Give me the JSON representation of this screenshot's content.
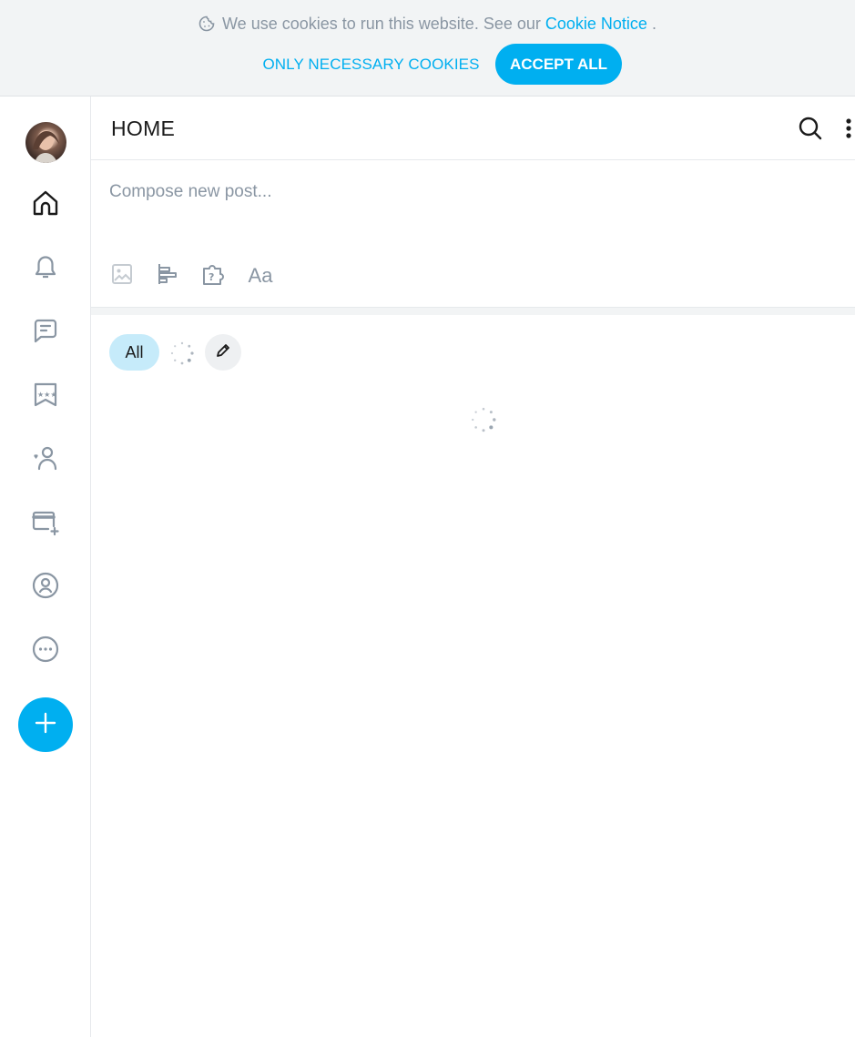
{
  "cookie_banner": {
    "text": "We use cookies to run this website. See our",
    "link_label": "Cookie Notice",
    "suffix": ".",
    "necessary_label": "ONLY NECESSARY COOKIES",
    "accept_label": "ACCEPT ALL",
    "icon": "cookie-icon"
  },
  "sidebar": {
    "items": [
      {
        "name": "home",
        "icon": "home-icon"
      },
      {
        "name": "notifications",
        "icon": "bell-icon"
      },
      {
        "name": "messages",
        "icon": "message-icon"
      },
      {
        "name": "collections",
        "icon": "bookmark-stars-icon"
      },
      {
        "name": "subscriptions",
        "icon": "user-heart-icon"
      },
      {
        "name": "add-card",
        "icon": "card-plus-icon"
      },
      {
        "name": "my-profile",
        "icon": "profile-circle-icon"
      },
      {
        "name": "more",
        "icon": "more-horizontal-icon"
      }
    ],
    "fab_icon": "plus-icon"
  },
  "header": {
    "title": "HOME"
  },
  "composer": {
    "placeholder": "Compose new post...",
    "tools": [
      "image-icon",
      "poll-icon",
      "quiz-icon",
      "text-format-icon"
    ],
    "text_tool_label": "Aa"
  },
  "filters": {
    "all_label": "All"
  },
  "colors": {
    "accent": "#00aff0",
    "muted": "#8a96a3",
    "chip_bg": "#c6ebfa",
    "banner_bg": "#f2f4f5"
  }
}
